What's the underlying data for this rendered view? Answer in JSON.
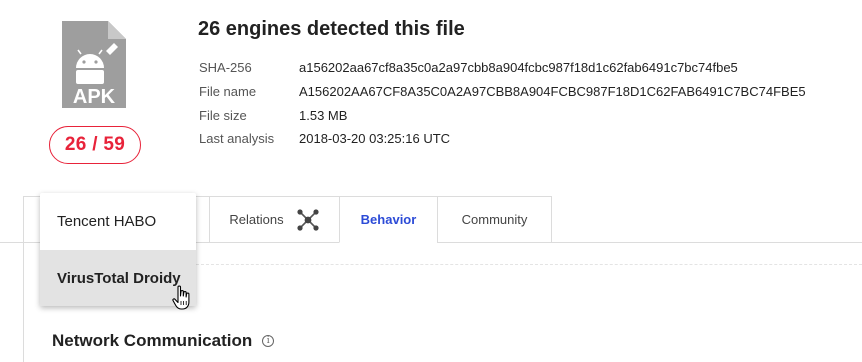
{
  "file": {
    "type_label": "APK",
    "score": "26 / 59",
    "title": "26 engines detected this file",
    "details": [
      {
        "key": "SHA-256",
        "value": "a156202aa67cf8a35c0a2a97cbb8a904fcbc987f18d1c62fab6491c7bc74fbe5"
      },
      {
        "key": "File name",
        "value": "A156202AA67CF8A35C0A2A97CBB8A904FCBC987F18D1C62FAB6491C7BC74FBE5"
      },
      {
        "key": "File size",
        "value": "1.53 MB"
      },
      {
        "key": "Last analysis",
        "value": "2018-03-20 03:25:16 UTC"
      }
    ]
  },
  "tabs": {
    "relations": "Relations",
    "behavior": "Behavior",
    "community": "Community"
  },
  "dropdown": {
    "items": [
      {
        "label": "Tencent HABO"
      },
      {
        "label": "VirusTotal Droidy"
      }
    ]
  },
  "section": {
    "title": "Network Communication",
    "info_icon": "info-icon"
  },
  "colors": {
    "detection_red": "#e8233a",
    "active_tab_blue": "#2c4bd7",
    "icon_gray": "#9e9e9e"
  }
}
